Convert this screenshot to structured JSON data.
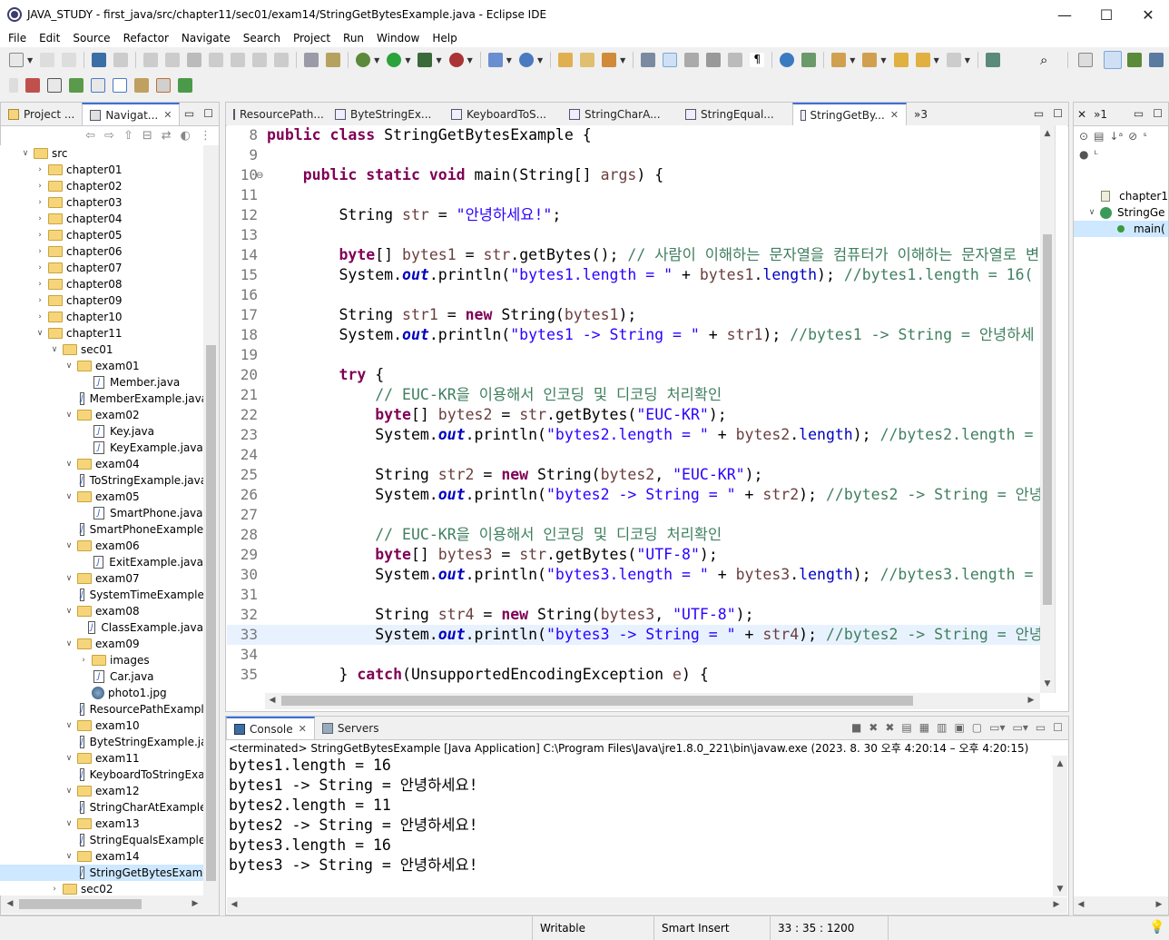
{
  "window": {
    "title": "JAVA_STUDY - first_java/src/chapter11/sec01/exam14/StringGetBytesExample.java - Eclipse IDE",
    "minimize": "—",
    "maximize": "☐",
    "close": "✕"
  },
  "menu": [
    "File",
    "Edit",
    "Source",
    "Refactor",
    "Navigate",
    "Search",
    "Project",
    "Run",
    "Window",
    "Help"
  ],
  "left_panel": {
    "tabs": [
      {
        "label": "Project ..."
      },
      {
        "label": "Navigat..."
      }
    ],
    "tree": [
      {
        "label": "src",
        "type": "folder",
        "depth": 0,
        "expanded": true
      },
      {
        "label": "chapter01",
        "type": "folder",
        "depth": 1,
        "expanded": false
      },
      {
        "label": "chapter02",
        "type": "folder",
        "depth": 1,
        "expanded": false
      },
      {
        "label": "chapter03",
        "type": "folder",
        "depth": 1,
        "expanded": false
      },
      {
        "label": "chapter04",
        "type": "folder",
        "depth": 1,
        "expanded": false
      },
      {
        "label": "chapter05",
        "type": "folder",
        "depth": 1,
        "expanded": false
      },
      {
        "label": "chapter06",
        "type": "folder",
        "depth": 1,
        "expanded": false
      },
      {
        "label": "chapter07",
        "type": "folder",
        "depth": 1,
        "expanded": false
      },
      {
        "label": "chapter08",
        "type": "folder",
        "depth": 1,
        "expanded": false
      },
      {
        "label": "chapter09",
        "type": "folder",
        "depth": 1,
        "expanded": false
      },
      {
        "label": "chapter10",
        "type": "folder",
        "depth": 1,
        "expanded": false
      },
      {
        "label": "chapter11",
        "type": "folder",
        "depth": 1,
        "expanded": true
      },
      {
        "label": "sec01",
        "type": "folder",
        "depth": 2,
        "expanded": true
      },
      {
        "label": "exam01",
        "type": "folder",
        "depth": 3,
        "expanded": true
      },
      {
        "label": "Member.java",
        "type": "java",
        "depth": 4
      },
      {
        "label": "MemberExample.java",
        "type": "java",
        "depth": 4
      },
      {
        "label": "exam02",
        "type": "folder",
        "depth": 3,
        "expanded": true
      },
      {
        "label": "Key.java",
        "type": "java",
        "depth": 4
      },
      {
        "label": "KeyExample.java",
        "type": "java",
        "depth": 4
      },
      {
        "label": "exam04",
        "type": "folder",
        "depth": 3,
        "expanded": true
      },
      {
        "label": "ToStringExample.java",
        "type": "java",
        "depth": 4
      },
      {
        "label": "exam05",
        "type": "folder",
        "depth": 3,
        "expanded": true
      },
      {
        "label": "SmartPhone.java",
        "type": "java",
        "depth": 4
      },
      {
        "label": "SmartPhoneExample.java",
        "type": "java",
        "depth": 4
      },
      {
        "label": "exam06",
        "type": "folder",
        "depth": 3,
        "expanded": true
      },
      {
        "label": "ExitExample.java",
        "type": "java",
        "depth": 4
      },
      {
        "label": "exam07",
        "type": "folder",
        "depth": 3,
        "expanded": true
      },
      {
        "label": "SystemTimeExample.java",
        "type": "java",
        "depth": 4
      },
      {
        "label": "exam08",
        "type": "folder",
        "depth": 3,
        "expanded": true
      },
      {
        "label": "ClassExample.java",
        "type": "java",
        "depth": 4
      },
      {
        "label": "exam09",
        "type": "folder",
        "depth": 3,
        "expanded": true
      },
      {
        "label": "images",
        "type": "folder",
        "depth": 4,
        "expanded": false
      },
      {
        "label": "Car.java",
        "type": "java",
        "depth": 4
      },
      {
        "label": "photo1.jpg",
        "type": "image",
        "depth": 4
      },
      {
        "label": "ResourcePathExample.java",
        "type": "java",
        "depth": 4
      },
      {
        "label": "exam10",
        "type": "folder",
        "depth": 3,
        "expanded": true
      },
      {
        "label": "ByteStringExample.java",
        "type": "java",
        "depth": 4
      },
      {
        "label": "exam11",
        "type": "folder",
        "depth": 3,
        "expanded": true
      },
      {
        "label": "KeyboardToStringExample.java",
        "type": "java",
        "depth": 4
      },
      {
        "label": "exam12",
        "type": "folder",
        "depth": 3,
        "expanded": true
      },
      {
        "label": "StringCharAtExample.java",
        "type": "java",
        "depth": 4
      },
      {
        "label": "exam13",
        "type": "folder",
        "depth": 3,
        "expanded": true
      },
      {
        "label": "StringEqualsExample.java",
        "type": "java",
        "depth": 4
      },
      {
        "label": "exam14",
        "type": "folder",
        "depth": 3,
        "expanded": true
      },
      {
        "label": "StringGetBytesExample.java",
        "type": "java",
        "depth": 4,
        "selected": true
      },
      {
        "label": "sec02",
        "type": "folder",
        "depth": 2,
        "expanded": false
      }
    ]
  },
  "editor": {
    "tabs": [
      {
        "label": "ResourcePath..."
      },
      {
        "label": "ByteStringEx..."
      },
      {
        "label": "KeyboardToS..."
      },
      {
        "label": "StringCharA..."
      },
      {
        "label": "StringEqual..."
      },
      {
        "label": "StringGetBy...",
        "active": true
      }
    ],
    "overflow": "»3",
    "current_line": 33,
    "lines": [
      {
        "n": "8",
        "tokens": [
          [
            "kw",
            "public"
          ],
          [
            "t",
            " "
          ],
          [
            "kw",
            "class"
          ],
          [
            "t",
            " StringGetBytesExample {"
          ]
        ]
      },
      {
        "n": "9",
        "tokens": []
      },
      {
        "n": "10",
        "tokens": [
          [
            "t",
            "    "
          ],
          [
            "kw",
            "public"
          ],
          [
            "t",
            " "
          ],
          [
            "kw",
            "static"
          ],
          [
            "t",
            " "
          ],
          [
            "kw",
            "void"
          ],
          [
            "t",
            " main(String[] "
          ],
          [
            "var",
            "args"
          ],
          [
            "t",
            ") {"
          ]
        ]
      },
      {
        "n": "11",
        "tokens": []
      },
      {
        "n": "12",
        "tokens": [
          [
            "t",
            "        String "
          ],
          [
            "var",
            "str"
          ],
          [
            "t",
            " = "
          ],
          [
            "str",
            "\"안녕하세요!\""
          ],
          [
            "t",
            ";"
          ]
        ]
      },
      {
        "n": "13",
        "tokens": []
      },
      {
        "n": "14",
        "tokens": [
          [
            "t",
            "        "
          ],
          [
            "kw",
            "byte"
          ],
          [
            "t",
            "[] "
          ],
          [
            "var",
            "bytes1"
          ],
          [
            "t",
            " = "
          ],
          [
            "var",
            "str"
          ],
          [
            "t",
            ".getBytes(); "
          ],
          [
            "cm",
            "// 사람이 이해하는 문자열을 컴퓨터가 이해하는 문자열로 변환"
          ]
        ]
      },
      {
        "n": "15",
        "tokens": [
          [
            "t",
            "        System."
          ],
          [
            "fld",
            "out"
          ],
          [
            "t",
            ".println("
          ],
          [
            "str",
            "\"bytes1.length = \""
          ],
          [
            "t",
            " + "
          ],
          [
            "var",
            "bytes1"
          ],
          [
            "t",
            "."
          ],
          [
            "fldn",
            "length"
          ],
          [
            "t",
            "); "
          ],
          [
            "cm",
            "//bytes1.length = 16("
          ]
        ]
      },
      {
        "n": "16",
        "tokens": []
      },
      {
        "n": "17",
        "tokens": [
          [
            "t",
            "        String "
          ],
          [
            "var",
            "str1"
          ],
          [
            "t",
            " = "
          ],
          [
            "kw",
            "new"
          ],
          [
            "t",
            " String("
          ],
          [
            "var",
            "bytes1"
          ],
          [
            "t",
            ");"
          ]
        ]
      },
      {
        "n": "18",
        "tokens": [
          [
            "t",
            "        System."
          ],
          [
            "fld",
            "out"
          ],
          [
            "t",
            ".println("
          ],
          [
            "str",
            "\"bytes1 -> String = \""
          ],
          [
            "t",
            " + "
          ],
          [
            "var",
            "str1"
          ],
          [
            "t",
            "); "
          ],
          [
            "cm",
            "//bytes1 -> String = 안녕하세"
          ]
        ]
      },
      {
        "n": "19",
        "tokens": []
      },
      {
        "n": "20",
        "tokens": [
          [
            "t",
            "        "
          ],
          [
            "kw",
            "try"
          ],
          [
            "t",
            " {"
          ]
        ]
      },
      {
        "n": "21",
        "tokens": [
          [
            "t",
            "            "
          ],
          [
            "cm",
            "// EUC-KR을 이용해서 인코딩 및 디코딩 처리확인"
          ]
        ]
      },
      {
        "n": "22",
        "tokens": [
          [
            "t",
            "            "
          ],
          [
            "kw",
            "byte"
          ],
          [
            "t",
            "[] "
          ],
          [
            "var",
            "bytes2"
          ],
          [
            "t",
            " = "
          ],
          [
            "var",
            "str"
          ],
          [
            "t",
            ".getBytes("
          ],
          [
            "str",
            "\"EUC-KR\""
          ],
          [
            "t",
            ");"
          ]
        ]
      },
      {
        "n": "23",
        "tokens": [
          [
            "t",
            "            System."
          ],
          [
            "fld",
            "out"
          ],
          [
            "t",
            ".println("
          ],
          [
            "str",
            "\"bytes2.length = \""
          ],
          [
            "t",
            " + "
          ],
          [
            "var",
            "bytes2"
          ],
          [
            "t",
            "."
          ],
          [
            "fldn",
            "length"
          ],
          [
            "t",
            "); "
          ],
          [
            "cm",
            "//bytes2.length = "
          ]
        ]
      },
      {
        "n": "24",
        "tokens": []
      },
      {
        "n": "25",
        "tokens": [
          [
            "t",
            "            String "
          ],
          [
            "var",
            "str2"
          ],
          [
            "t",
            " = "
          ],
          [
            "kw",
            "new"
          ],
          [
            "t",
            " String("
          ],
          [
            "var",
            "bytes2"
          ],
          [
            "t",
            ", "
          ],
          [
            "str",
            "\"EUC-KR\""
          ],
          [
            "t",
            ");"
          ]
        ]
      },
      {
        "n": "26",
        "tokens": [
          [
            "t",
            "            System."
          ],
          [
            "fld",
            "out"
          ],
          [
            "t",
            ".println("
          ],
          [
            "str",
            "\"bytes2 -> String = \""
          ],
          [
            "t",
            " + "
          ],
          [
            "var",
            "str2"
          ],
          [
            "t",
            "); "
          ],
          [
            "cm",
            "//bytes2 -> String = 안녕"
          ]
        ]
      },
      {
        "n": "27",
        "tokens": []
      },
      {
        "n": "28",
        "tokens": [
          [
            "t",
            "            "
          ],
          [
            "cm",
            "// EUC-KR을 이용해서 인코딩 및 디코딩 처리확인"
          ]
        ]
      },
      {
        "n": "29",
        "tokens": [
          [
            "t",
            "            "
          ],
          [
            "kw",
            "byte"
          ],
          [
            "t",
            "[] "
          ],
          [
            "var",
            "bytes3"
          ],
          [
            "t",
            " = "
          ],
          [
            "var",
            "str"
          ],
          [
            "t",
            ".getBytes("
          ],
          [
            "str",
            "\"UTF-8\""
          ],
          [
            "t",
            ");"
          ]
        ]
      },
      {
        "n": "30",
        "tokens": [
          [
            "t",
            "            System."
          ],
          [
            "fld",
            "out"
          ],
          [
            "t",
            ".println("
          ],
          [
            "str",
            "\"bytes3.length = \""
          ],
          [
            "t",
            " + "
          ],
          [
            "var",
            "bytes3"
          ],
          [
            "t",
            "."
          ],
          [
            "fldn",
            "length"
          ],
          [
            "t",
            "); "
          ],
          [
            "cm",
            "//bytes3.length = "
          ]
        ]
      },
      {
        "n": "31",
        "tokens": []
      },
      {
        "n": "32",
        "tokens": [
          [
            "t",
            "            String "
          ],
          [
            "var",
            "str4"
          ],
          [
            "t",
            " = "
          ],
          [
            "kw",
            "new"
          ],
          [
            "t",
            " String("
          ],
          [
            "var",
            "bytes3"
          ],
          [
            "t",
            ", "
          ],
          [
            "str",
            "\"UTF-8\""
          ],
          [
            "t",
            ");"
          ]
        ]
      },
      {
        "n": "33",
        "tokens": [
          [
            "t",
            "            System."
          ],
          [
            "fld",
            "out"
          ],
          [
            "t",
            ".println("
          ],
          [
            "str",
            "\"bytes3 -> String = \""
          ],
          [
            "t",
            " + "
          ],
          [
            "var",
            "str4"
          ],
          [
            "t",
            "); "
          ],
          [
            "cm",
            "//bytes2 -> String = 안녕"
          ]
        ]
      },
      {
        "n": "34",
        "tokens": []
      },
      {
        "n": "35",
        "tokens": [
          [
            "t",
            "        } "
          ],
          [
            "kw",
            "catch"
          ],
          [
            "t",
            "(UnsupportedEncodingException "
          ],
          [
            "var",
            "e"
          ],
          [
            "t",
            ") {"
          ]
        ]
      }
    ]
  },
  "outline": {
    "tab": "»1",
    "items": [
      {
        "label": "chapter1"
      },
      {
        "label": "StringGe"
      },
      {
        "label": "main("
      }
    ]
  },
  "console": {
    "tabs": [
      {
        "label": "Console",
        "active": true
      },
      {
        "label": "Servers"
      }
    ],
    "header": "<terminated> StringGetBytesExample [Java Application] C:\\Program Files\\Java\\jre1.8.0_221\\bin\\javaw.exe  (2023. 8. 30 오후 4:20:14 – 오후 4:20:15)",
    "output": [
      "bytes1.length = 16",
      "bytes1 -> String = 안녕하세요!",
      "bytes2.length = 11",
      "bytes2 -> String = 안녕하세요!",
      "bytes3.length = 16",
      "bytes3 -> String = 안녕하세요!"
    ]
  },
  "status": {
    "writable": "Writable",
    "insert_mode": "Smart Insert",
    "position": "33 : 35 : 1200"
  },
  "colors": {
    "keyword": "#7f0055",
    "string": "#2a00ff",
    "comment": "#3f7f5f",
    "field": "#0000c0",
    "selection": "#cde8ff",
    "current_line": "#e8f2fe"
  }
}
